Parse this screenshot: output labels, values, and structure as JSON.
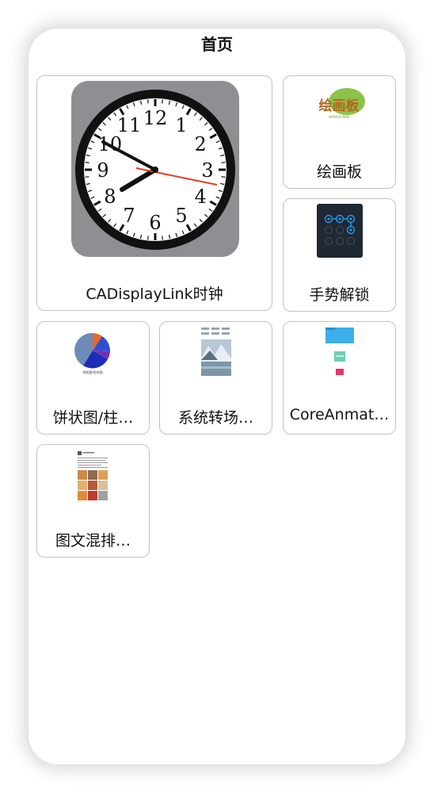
{
  "nav": {
    "title": "首页"
  },
  "cells": [
    {
      "label": "CADisplayLink时钟",
      "icon": "analog-clock-thumbnail"
    },
    {
      "label": "绘画板",
      "icon": "drawing-board-logo",
      "logo_text": "绘画板",
      "logo_subtext": "HUIHUA BAN",
      "accent": "#8bc34a"
    },
    {
      "label": "手势解锁",
      "icon": "gesture-lock-thumbnail",
      "accent": "#1e9cf0"
    },
    {
      "label": "饼状图/柱…",
      "icon": "pie-chart-thumbnail",
      "caption": "饼状图/柱状图"
    },
    {
      "label": "系统转场…",
      "icon": "transition-thumbnail"
    },
    {
      "label": "CoreAnmat…",
      "icon": "core-animation-thumbnail",
      "colors": [
        "#3daee9",
        "#6fd0b0",
        "#e8336a"
      ]
    },
    {
      "label": "图文混排…",
      "icon": "rich-text-thumbnail"
    }
  ],
  "clock": {
    "numerals": [
      "12",
      "1",
      "2",
      "3",
      "4",
      "5",
      "6",
      "7",
      "8",
      "9",
      "10",
      "11"
    ]
  }
}
